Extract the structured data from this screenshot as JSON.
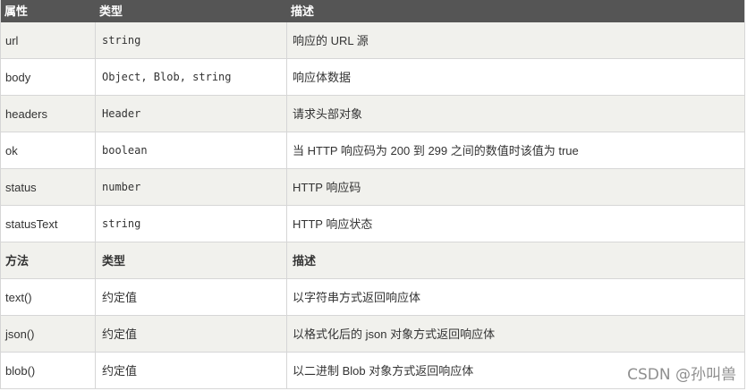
{
  "header": {
    "col1": "属性",
    "col2": "类型",
    "col3": "描述"
  },
  "properties": [
    {
      "name": "url",
      "type": "string",
      "desc": "响应的 URL 源"
    },
    {
      "name": "body",
      "type": "Object, Blob, string",
      "desc": "响应体数据"
    },
    {
      "name": "headers",
      "type": "Header",
      "desc": "请求头部对象"
    },
    {
      "name": "ok",
      "type": "boolean",
      "desc": "当 HTTP 响应码为 200 到 299 之间的数值时该值为 true"
    },
    {
      "name": "status",
      "type": "number",
      "desc": "HTTP 响应码"
    },
    {
      "name": "statusText",
      "type": "string",
      "desc": "HTTP 响应状态"
    }
  ],
  "methods_header": {
    "col1": "方法",
    "col2": "类型",
    "col3": "描述"
  },
  "methods": [
    {
      "name": "text()",
      "type": "约定值",
      "desc": "以字符串方式返回响应体"
    },
    {
      "name": "json()",
      "type": "约定值",
      "desc": "以格式化后的 json 对象方式返回响应体"
    },
    {
      "name": "blob()",
      "type": "约定值",
      "desc": "以二进制 Blob 对象方式返回响应体"
    }
  ],
  "watermark": "CSDN @孙叫兽"
}
